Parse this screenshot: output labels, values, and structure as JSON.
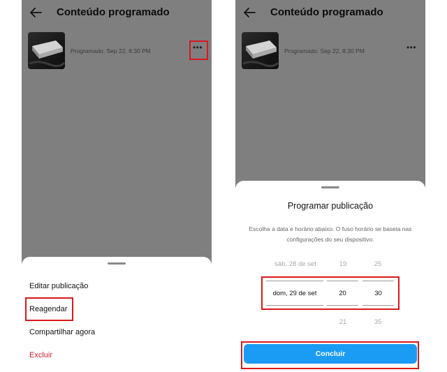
{
  "left_screen": {
    "header": {
      "title": "Conteúdo programado"
    },
    "post": {
      "status": "Programado: Sep 22, 8:30 PM"
    },
    "menu": {
      "items": [
        {
          "label": "Editar publicação"
        },
        {
          "label": "Reagendar"
        },
        {
          "label": "Compartilhar agora"
        },
        {
          "label": "Excluir"
        }
      ]
    }
  },
  "right_screen": {
    "header": {
      "title": "Conteúdo programado"
    },
    "post": {
      "status": "Programado: Sep 22, 8:30 PM"
    },
    "sheet": {
      "title": "Programar publicação",
      "description": "Escolha a data e horário abaixo. O fuso horário se baseia nas configurações do seu dispositivo.",
      "picker": {
        "date": {
          "prev": "sáb, 28 de set",
          "selected": "dom, 29 de set"
        },
        "hour": {
          "prev": "19",
          "selected": "20",
          "next": "21"
        },
        "minute": {
          "prev": "25",
          "selected": "30",
          "next": "35"
        }
      },
      "done_label": "Concluir"
    }
  },
  "colors": {
    "dim_overlay": "#7f7f7f",
    "highlight": "#d7191e",
    "primary": "#1a9cf5",
    "danger": "#d21f2e"
  },
  "icons": [
    "back-arrow-icon",
    "more-options-icon"
  ]
}
